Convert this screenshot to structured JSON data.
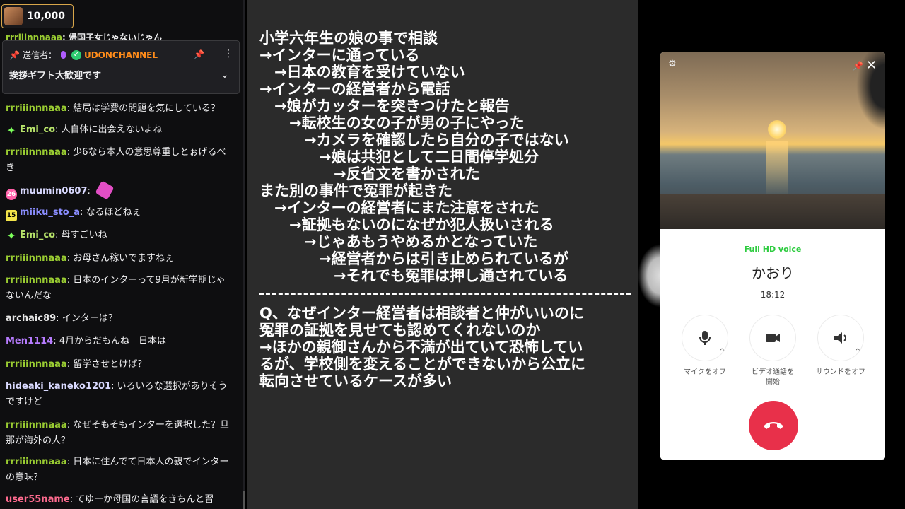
{
  "chat": {
    "points": "10,000",
    "partial_top_message": {
      "user": "rrriiinnnaaa",
      "text": "帰国子女じゃないじゃん"
    },
    "pinned": {
      "sender_label": "送信者：",
      "sender_name": "UDONCHANNEL",
      "message": "挨拶ギフト大歓迎です"
    },
    "messages": [
      {
        "user": "rrriiinnnaaa",
        "color": "#9acd32",
        "badge": "",
        "text": "結局は学費の問題を気にしている？"
      },
      {
        "user": "Emi_co",
        "color": "#b7e36a",
        "badge": "diamond",
        "text": "人自体に出会えないよね"
      },
      {
        "user": "rrriiinnnaaa",
        "color": "#9acd32",
        "badge": "",
        "text": "少6なら本人の意思尊重しとぉげるべき"
      },
      {
        "user": "muumin0607",
        "color": "#d9d9ff",
        "badge": "26",
        "text": ""
      },
      {
        "user": "miiku_sto_a",
        "color": "#8a8dff",
        "badge": "15",
        "text": "なるほどねぇ"
      },
      {
        "user": "Emi_co",
        "color": "#b7e36a",
        "badge": "diamond",
        "text": "母すごいね"
      },
      {
        "user": "rrriiinnnaaa",
        "color": "#9acd32",
        "badge": "",
        "text": "お母さん稼いでますねぇ"
      },
      {
        "user": "rrriiinnnaaa",
        "color": "#9acd32",
        "badge": "",
        "text": "日本のインターって9月が新学期じゃないんだな"
      },
      {
        "user": "archaic89",
        "color": "#e6e6e6",
        "badge": "",
        "text": "インターは？"
      },
      {
        "user": "Men1114",
        "color": "#b77cff",
        "badge": "",
        "text": "4月からだもんね　日本は"
      },
      {
        "user": "rrriiinnnaaa",
        "color": "#9acd32",
        "badge": "",
        "text": "留学させとけば？"
      },
      {
        "user": "hideaki_kaneko1201",
        "color": "#d9d9ff",
        "badge": "",
        "text": "いろいろな選択がありそうですけど"
      },
      {
        "user": "rrriiinnnaaa",
        "color": "#9acd32",
        "badge": "",
        "text": "なぜそもそもインターを選択した？旦那が海外の人？"
      },
      {
        "user": "rrriiinnnaaa",
        "color": "#9acd32",
        "badge": "",
        "text": "日本に住んでて日本人の親でインターの意味？"
      },
      {
        "user": "user55name",
        "color": "#ff6b8f",
        "badge": "",
        "text": "てゆーか母国の言語をきちんと習"
      }
    ]
  },
  "notes": {
    "lines": [
      "小学六年生の娘の事で相談",
      "→インターに通っている",
      "　→日本の教育を受けていない",
      "→インターの経営者から電話",
      "　→娘がカッターを突きつけたと報告",
      "　　→転校生の女の子が男の子にやった",
      "　　　→カメラを確認したら自分の子ではない",
      "　　　　→娘は共犯として二日間停学処分",
      "　　　　　→反省文を書かされた",
      "また別の事件で冤罪が起きた",
      "　→インターの経営者にまた注意をされた",
      "　　→証拠もないのになぜか犯人扱いされる",
      "　　　→じゃあもうやめるかとなっていた",
      "　　　　→経営者からは引き止められているが",
      "　　　　　→それでも冤罪は押し通されている"
    ],
    "lines2": [
      "Q、なぜインター経営者は相談者と仲がいいのに",
      "冤罪の証拠を見せても認めてくれないのか",
      "→ほかの親御さんから不満が出ていて恐怖してい",
      "るが、学校側を変えることができないから公立に",
      "転向させているケースが多い"
    ]
  },
  "call": {
    "quality": "Full HD voice",
    "contact_name": "かおり",
    "duration": "18:12",
    "mic_label": "マイクをオフ",
    "video_label_1": "ビデオ通話を",
    "video_label_2": "開始",
    "sound_label": "サウンドをオフ"
  }
}
